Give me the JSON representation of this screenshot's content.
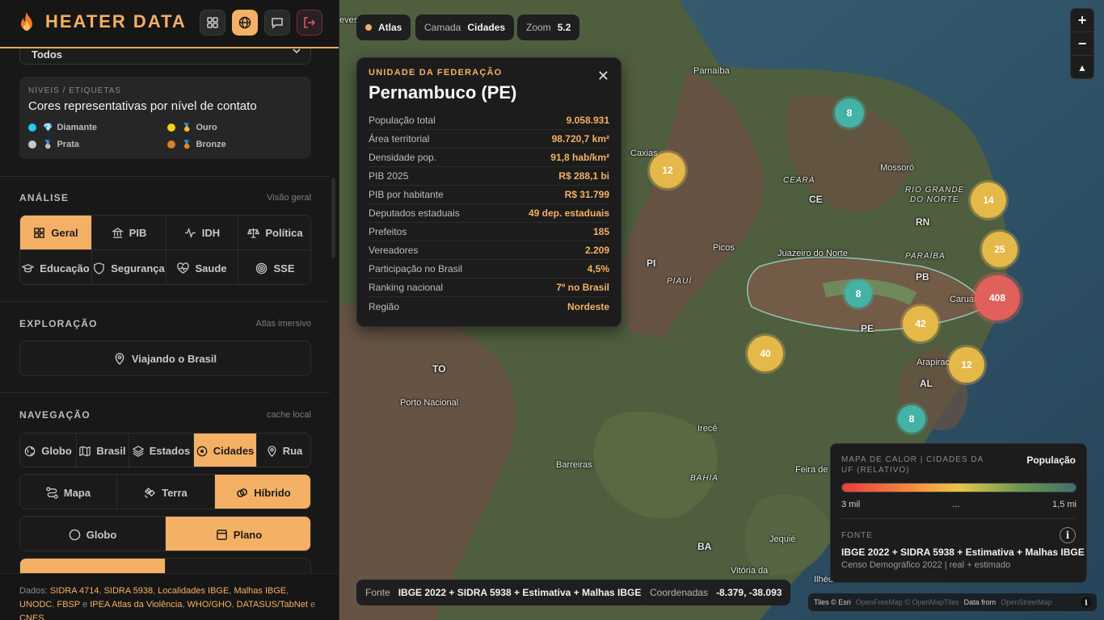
{
  "app": {
    "title": "HEATER DATA"
  },
  "filter": {
    "selected": "Todos"
  },
  "levels": {
    "caption": "NÍVEIS / ETIQUETAS",
    "heading": "Cores representativas por nível de contato",
    "items": [
      {
        "label": "Diamante",
        "color": "#22c9e8"
      },
      {
        "label": "Ouro",
        "color": "#f5d20f"
      },
      {
        "label": "Prata",
        "color": "#c8c8c8"
      },
      {
        "label": "Bronze",
        "color": "#d9822e"
      }
    ]
  },
  "analysis": {
    "title": "ANÁLISE",
    "note": "Visão geral",
    "tabs": [
      {
        "label": "Geral",
        "icon": "grid-icon"
      },
      {
        "label": "PIB",
        "icon": "bank-icon"
      },
      {
        "label": "IDH",
        "icon": "pulse-icon"
      },
      {
        "label": "Política",
        "icon": "scale-icon"
      },
      {
        "label": "Educação",
        "icon": "graduation-icon"
      },
      {
        "label": "Segurança",
        "icon": "shield-icon"
      },
      {
        "label": "Saude",
        "icon": "heart-icon"
      },
      {
        "label": "SSE",
        "icon": "target-icon"
      }
    ]
  },
  "exploration": {
    "title": "EXPLORAÇÃO",
    "note": "Atlas imersivo",
    "button": "Viajando o Brasil"
  },
  "navigation": {
    "title": "NAVEGAÇÃO",
    "note": "cache local",
    "levels": [
      "Globo",
      "Brasil",
      "Estados",
      "Cidades",
      "Rua"
    ],
    "styles": [
      "Mapa",
      "Terra",
      "Híbrido"
    ],
    "projection": [
      "Globo",
      "Plano"
    ]
  },
  "footer": {
    "prefix": "Dados:",
    "sources": [
      "SIDRA 4714",
      "SIDRA 5938",
      "Localidades IBGE",
      "Malhas IBGE",
      "UNODC",
      "FBSP",
      "IPEA Atlas da Violência",
      "WHO/GHO",
      "DATASUS/TabNet",
      "CNES"
    ],
    "and": "e"
  },
  "map": {
    "chips": {
      "atlas": "Atlas",
      "layer_label": "Camada",
      "layer_value": "Cidades",
      "zoom_label": "Zoom",
      "zoom_value": "5.2"
    },
    "labels": [
      "Parnaíba",
      "Caxias",
      "Mossoró",
      "Picos",
      "Juazeiro do Norte",
      "Caruaru",
      "Arapiraca",
      "Porto Nacional",
      "Irecê",
      "Barreiras",
      "Feira de",
      "Jequié",
      "Vitória da",
      "Ilhéu",
      "eves"
    ],
    "states": [
      "CE",
      "RN",
      "PB",
      "PE",
      "PI",
      "AL",
      "TO",
      "BA"
    ],
    "regions": [
      "CEARÁ",
      "RIO GRANDE",
      "DO NORTE",
      "PARAÍBA",
      "PIAUÍ",
      "BAHIA"
    ],
    "clusters": [
      {
        "value": "8",
        "color": "#44b3a6"
      },
      {
        "value": "12",
        "color": "#e5b84a"
      },
      {
        "value": "14",
        "color": "#e5b84a"
      },
      {
        "value": "25",
        "color": "#e5b84a"
      },
      {
        "value": "408",
        "color": "#e0605a"
      },
      {
        "value": "8",
        "color": "#44b3a6"
      },
      {
        "value": "42",
        "color": "#e5b84a"
      },
      {
        "value": "40",
        "color": "#e5b84a"
      },
      {
        "value": "12",
        "color": "#e5b84a"
      },
      {
        "value": "8",
        "color": "#44b3a6"
      }
    ],
    "footer_source_label": "Fonte",
    "footer_source": "IBGE 2022 + SIDRA 5938 + Estimativa + Malhas IBGE",
    "coords_label": "Coordenadas",
    "coords": "-8.379, -38.093",
    "attribution": {
      "tiles": "Tiles © Esri",
      "osm": "OpenFreeMap © OpenMapTiles",
      "data": "Data from",
      "osm2": "OpenStreetMap"
    }
  },
  "popup": {
    "caption": "UNIDADE DA FEDERAÇÃO",
    "title": "Pernambuco (PE)",
    "rows": [
      {
        "label": "População total",
        "value": "9.058.931"
      },
      {
        "label": "Área territorial",
        "value": "98.720,7 km²"
      },
      {
        "label": "Densidade pop.",
        "value": "91,8 hab/km²"
      },
      {
        "label": "PIB 2025",
        "value": "R$ 288,1 bi"
      },
      {
        "label": "PIB por habitante",
        "value": "R$ 31.799"
      },
      {
        "label": "Deputados estaduais",
        "value": "49 dep. estaduais"
      },
      {
        "label": "Prefeitos",
        "value": "185"
      },
      {
        "label": "Vereadores",
        "value": "2.209"
      },
      {
        "label": "Participação no Brasil",
        "value": "4,5%"
      },
      {
        "label": "Ranking nacional",
        "value": "7º no Brasil"
      },
      {
        "label": "Região",
        "value": "Nordeste"
      }
    ]
  },
  "heatmap": {
    "caption": "MAPA DE CALOR | CIDADES DA UF (RELATIVO)",
    "metric": "População",
    "min": "3 mil",
    "mid": "...",
    "max": "1,5 mi",
    "source_caption": "FONTE",
    "source": "IBGE 2022 + SIDRA 5938 + Estimativa + Malhas IBGE",
    "desc": "Censo Demográfico 2022 | real + estimado"
  },
  "colors": {
    "accent": "#f4b064",
    "danger": "#e05a6a"
  }
}
